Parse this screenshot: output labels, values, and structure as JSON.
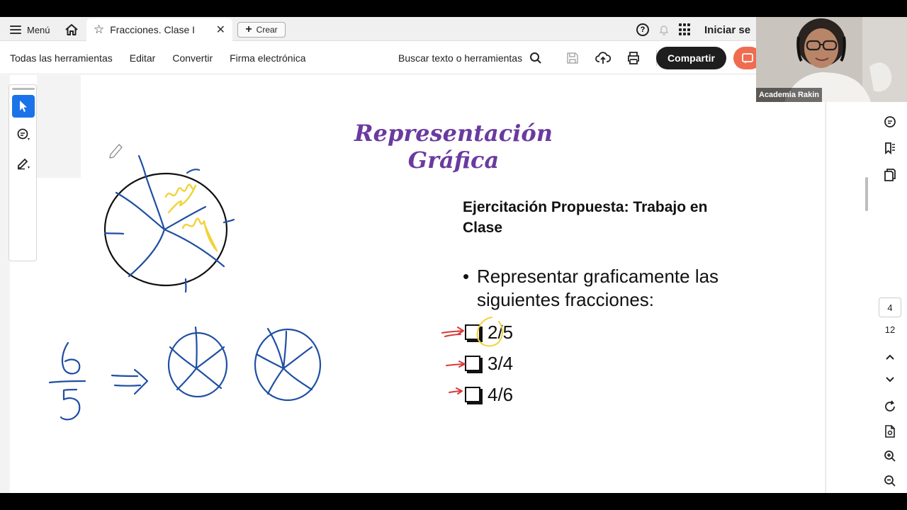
{
  "tabbar": {
    "menu_label": "Menú",
    "tab_title": "Fracciones. Clase I",
    "create_label": "Crear",
    "signin_label": "Iniciar se"
  },
  "toolsbar": {
    "nav": [
      "Todas las herramientas",
      "Editar",
      "Convertir",
      "Firma electrónica"
    ],
    "search_label": "Buscar texto o herramientas",
    "share_label": "Compartir"
  },
  "navigation": {
    "current_page": "4",
    "total_pages": "12"
  },
  "slide": {
    "title": "Representación Gráfica",
    "exercise_heading": "Ejercitación Propuesta: Trabajo en Clase",
    "bullet": "Representar graficamente las siguientes fracciones:",
    "fractions": [
      "2/5",
      "3/4",
      "4/6"
    ],
    "handwritten": {
      "numerator": "6",
      "denominator": "5"
    }
  },
  "webcam": {
    "participant_name": "Academia Rakin"
  },
  "colors": {
    "title_purple": "#6a3aa0",
    "ink_blue": "#1f4fa3",
    "ink_yellow": "#f2d23a",
    "ink_red": "#d83a3a",
    "share_dark": "#1e1e1e",
    "accent_orange": "#f06b4f",
    "tool_active_blue": "#1a73e8"
  }
}
